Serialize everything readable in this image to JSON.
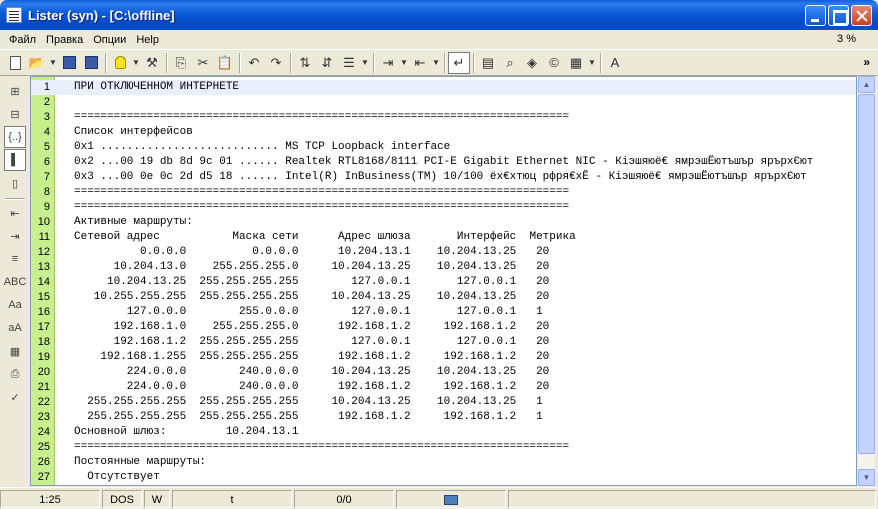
{
  "window": {
    "title": "Lister (syn) - [C:\\offline]"
  },
  "menu": {
    "items": [
      "Файл",
      "Правка",
      "Опции",
      "Help"
    ],
    "zoom": "3 %"
  },
  "toolbar": {
    "icons": [
      "new-file-icon",
      "open-folder-icon",
      "save-icon",
      "save-all-icon",
      "lightbulb-icon",
      "tools-icon",
      "copy-icon",
      "cut-icon",
      "paste-icon",
      "undo-icon",
      "redo-icon",
      "sort-asc-icon",
      "sort-desc-icon",
      "list-icon",
      "indent-icon",
      "outdent-icon",
      "word-wrap-icon",
      "table-icon",
      "find-icon",
      "browser-icon",
      "copyright-icon",
      "export-icon",
      "font-size-icon"
    ]
  },
  "lefttoolbar": {
    "icons": [
      "tree-icon",
      "tree-alt-icon",
      "bracket-icon",
      "text-view-icon",
      "page-icon",
      "indent-left-icon",
      "indent-right-icon",
      "align-icon",
      "abc-icon",
      "letter-case-icon",
      "letter-case-alt-icon",
      "calendar-icon",
      "print-icon",
      "spellcheck-icon"
    ]
  },
  "editor": {
    "current_line": 1,
    "lines": [
      "ПРИ ОТКЛЮЧЕННОМ ИНТЕРНЕТЕ",
      "",
      "===========================================================================",
      "Список интерфейсов",
      "0x1 ........................... MS TCP Loopback interface",
      "0x2 ...00 19 db 8d 9c 01 ...... Realtek RTL8168/8111 PCI-E Gigabit Ethernet NIC - Кіэшяюё€ ямрэшЁютъшър ярърхЄют",
      "0x3 ...00 0e 0c 2d d5 18 ...... Intel(R) InBusiness(TM) 10/100 ёх€хтюц рфря€хЁ - Кіэшяюё€ ямрэшЁютъшър ярърхЄют",
      "===========================================================================",
      "===========================================================================",
      "Активные маршруты:",
      "Сетевой адрес           Маска сети      Адрес шлюза       Интерфейс  Метрика",
      "          0.0.0.0          0.0.0.0      10.204.13.1    10.204.13.25   20",
      "      10.204.13.0    255.255.255.0     10.204.13.25    10.204.13.25   20",
      "     10.204.13.25  255.255.255.255        127.0.0.1       127.0.0.1   20",
      "   10.255.255.255  255.255.255.255     10.204.13.25    10.204.13.25   20",
      "        127.0.0.0        255.0.0.0        127.0.0.1       127.0.0.1   1",
      "      192.168.1.0    255.255.255.0      192.168.1.2     192.168.1.2   20",
      "      192.168.1.2  255.255.255.255        127.0.0.1       127.0.0.1   20",
      "    192.168.1.255  255.255.255.255      192.168.1.2     192.168.1.2   20",
      "        224.0.0.0        240.0.0.0     10.204.13.25    10.204.13.25   20",
      "        224.0.0.0        240.0.0.0      192.168.1.2     192.168.1.2   20",
      "  255.255.255.255  255.255.255.255     10.204.13.25    10.204.13.25   1",
      "  255.255.255.255  255.255.255.255      192.168.1.2     192.168.1.2   1",
      "Основной шлюз:         10.204.13.1",
      "===========================================================================",
      "Постоянные маршруты:",
      "  Отсутствует"
    ]
  },
  "status": {
    "position": "1:25",
    "encoding": "DOS",
    "mode": "W",
    "tabs": "t",
    "selection": "0/0"
  }
}
